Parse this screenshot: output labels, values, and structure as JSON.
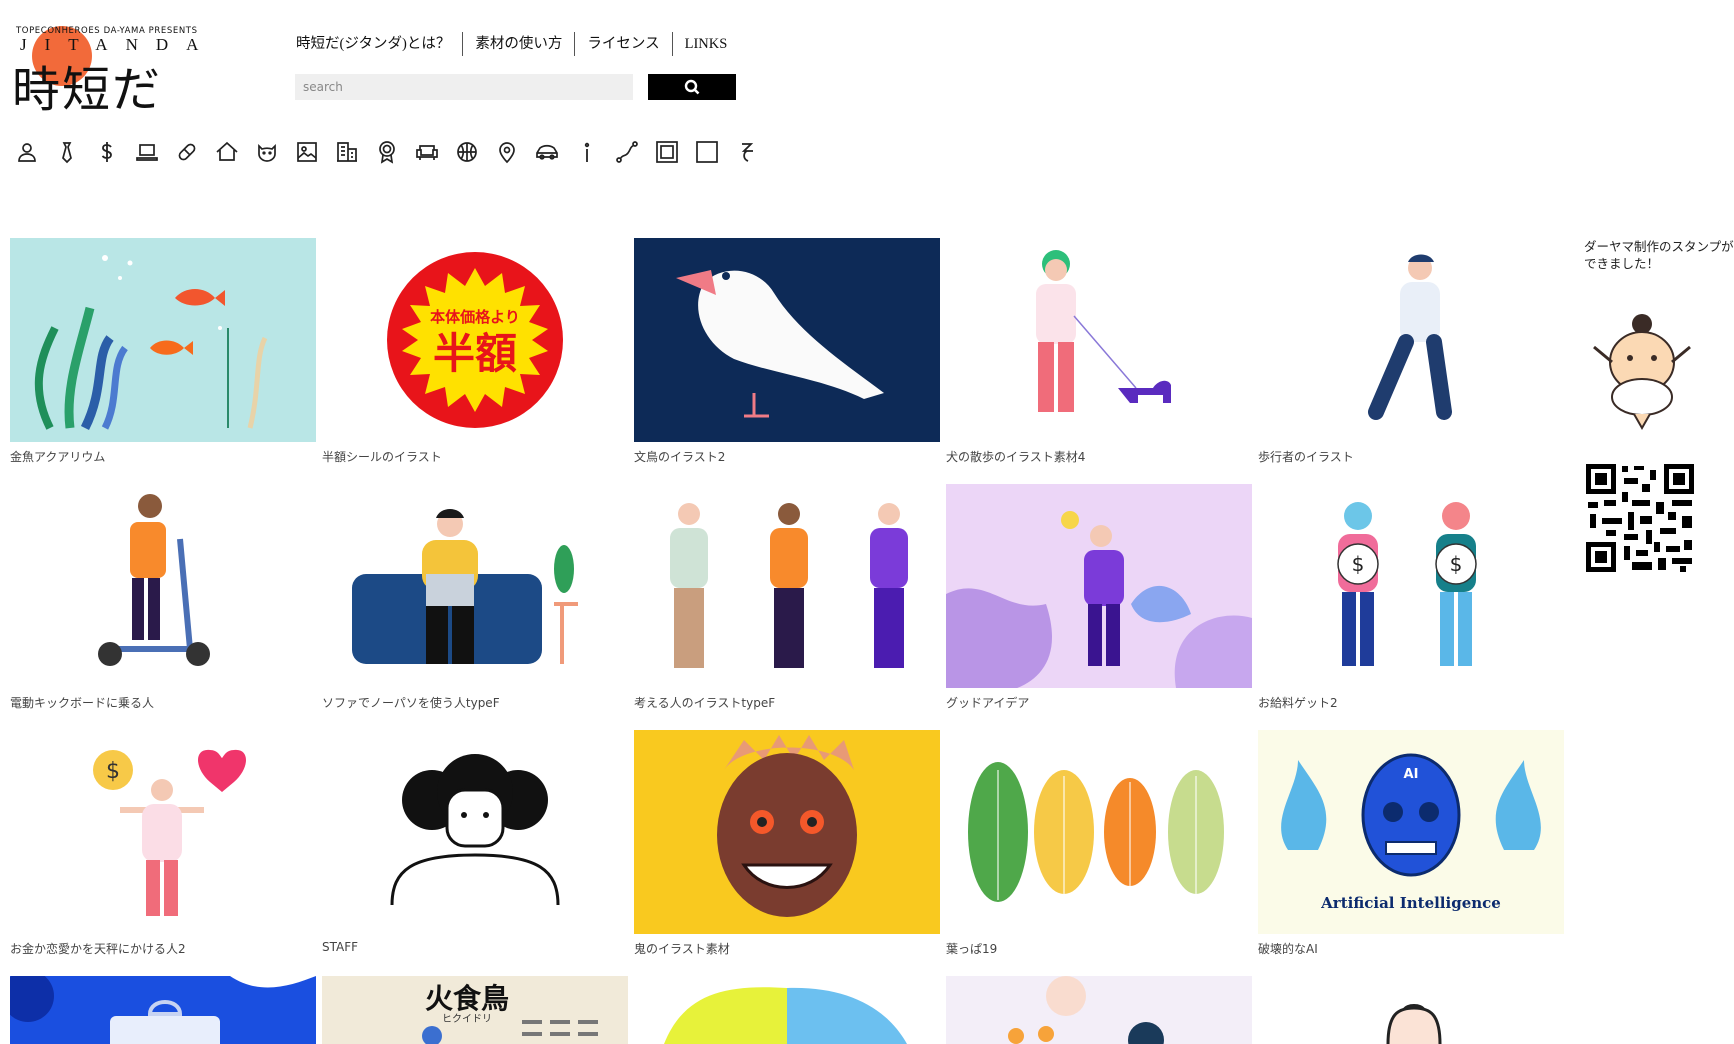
{
  "brand": {
    "top_line": "TOPECONHEROES DA-YAMA PRESENTS",
    "name_en": "JITANDA",
    "name_jp": "時短だ"
  },
  "nav": {
    "items": [
      "時短だ(ジタンダ)とは？",
      "素材の使い方",
      "ライセンス",
      "LINKS"
    ]
  },
  "search": {
    "placeholder": "search"
  },
  "categories": [
    "person-icon",
    "necktie-icon",
    "dollar-icon",
    "laptop-icon",
    "pill-icon",
    "house-icon",
    "cat-icon",
    "image-icon",
    "building-icon",
    "medal-icon",
    "sofa-icon",
    "basketball-icon",
    "map-pin-icon",
    "car-icon",
    "info-icon",
    "route-icon",
    "frame-icon",
    "square-icon",
    "other-icon"
  ],
  "items": [
    {
      "caption": "金魚アクアリウム",
      "bg": "#b9e6e6"
    },
    {
      "caption": "半額シールのイラスト",
      "bg": "#ffffff",
      "sticker_top": "本体価格より",
      "sticker_main": "半額"
    },
    {
      "caption": "文鳥のイラスト2",
      "bg": "#0d2a57"
    },
    {
      "caption": "犬の散歩のイラスト素材4",
      "bg": "#ffffff"
    },
    {
      "caption": "歩行者のイラスト",
      "bg": "#ffffff"
    },
    {
      "caption": "電動キックボードに乗る人",
      "bg": "#ffffff"
    },
    {
      "caption": "ソファでノーパソを使う人typeF",
      "bg": "#ffffff"
    },
    {
      "caption": "考える人のイラストtypeF",
      "bg": "#ffffff"
    },
    {
      "caption": "グッドアイデア",
      "bg": "#ecd6f7"
    },
    {
      "caption": "お給料ゲット2",
      "bg": "#ffffff"
    },
    {
      "caption": "お金か恋愛かを天秤にかける人2",
      "bg": "#ffffff"
    },
    {
      "caption": "STAFF",
      "bg": "#ffffff"
    },
    {
      "caption": "鬼のイラスト素材",
      "bg": "#f9c91f"
    },
    {
      "caption": "葉っぱ19",
      "bg": "#ffffff"
    },
    {
      "caption": "破壊的なAI",
      "bg": "#fbfbe8",
      "ai_badge": "AI",
      "ai_text": "Artificial Intelligence"
    },
    {
      "caption": "",
      "bg": "#1a4fe0"
    },
    {
      "caption": "",
      "bg": "#f1ead9",
      "title": "火食鳥",
      "subtitle": "ヒクイドリ"
    },
    {
      "caption": "",
      "bg": "#ffffff"
    },
    {
      "caption": "",
      "bg": "#f3eef8"
    },
    {
      "caption": "",
      "bg": "#ffffff"
    }
  ],
  "sidebar": {
    "stamp_note": "ダーヤマ制作のスタンプができました！"
  }
}
